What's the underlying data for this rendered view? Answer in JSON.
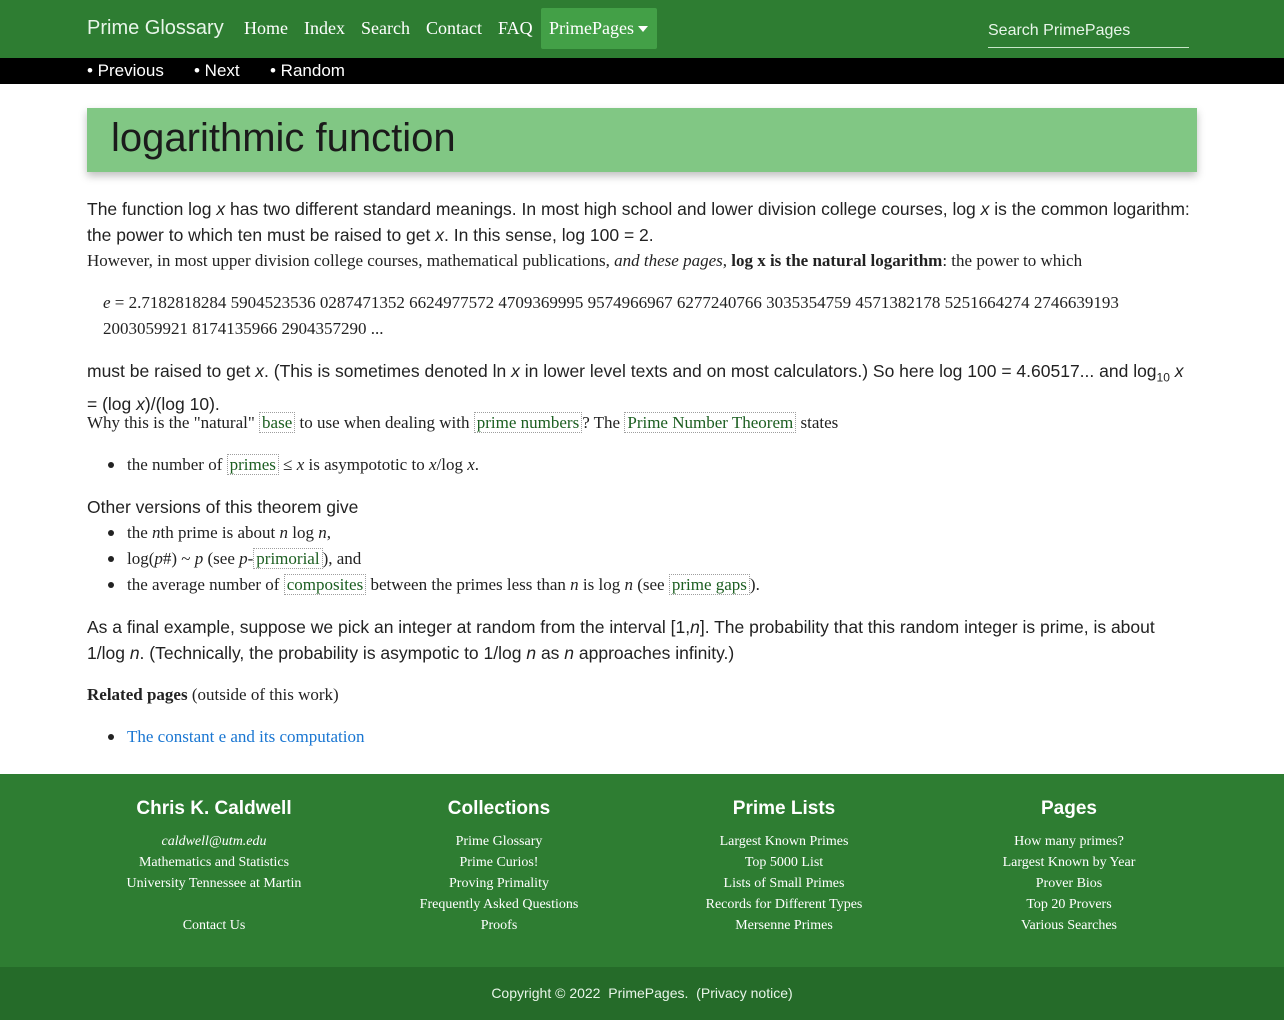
{
  "navbar": {
    "brand": "Prime Glossary",
    "links": [
      "Home",
      "Index",
      "Search",
      "Contact",
      "FAQ"
    ],
    "active": "PrimePages",
    "search_placeholder": "Search PrimePages"
  },
  "subnav": {
    "previous": "• Previous",
    "next": "• Next",
    "random": "• Random"
  },
  "title": "logarithmic function",
  "content": {
    "p1_a": "The function log ",
    "p1_b": " has two different standard meanings. In most high school and lower division college courses, log ",
    "p1_c": " is the common logarithm: the power to which ten must be raised to get ",
    "p1_d": ". In this sense, log 100 = 2.",
    "x": "x",
    "p2_a": "However, in most upper division college courses, mathematical publications, ",
    "p2_em": "and these pages",
    "p2_strong": "log x is the natural logarithm",
    "p2_b": ": the power to which",
    "e_var": "e",
    "e_value": " = 2.7182818284 5904523536 0287471352 6624977572 4709369995 9574966967 6277240766 3035354759 4571382178 5251664274 2746639193 2003059921 8174135966 2904357290 ...",
    "p3_a": "must be raised to get ",
    "p3_b": ". (This is sometimes denoted ln ",
    "p3_c": " in lower level texts and on most calculators.) So here log 100 = 4.60517... and log",
    "p3_sub": "10",
    "p3_d": " = (log ",
    "p3_e": ")/(log 10).",
    "p4_a": "Why this is the \"natural\" ",
    "p4_link1": "base",
    "p4_b": " to use when dealing with ",
    "p4_link2": "prime numbers",
    "p4_c": "? The ",
    "p4_link3": "Prime Number Theorem",
    "p4_d": " states",
    "li1_a": "the number of ",
    "li1_link": "primes",
    "li1_b": " ≤ ",
    "li1_c": " is asympototic to ",
    "li1_d": "/log ",
    "li1_e": ".",
    "p5": "Other versions of this theorem give",
    "li2_a": "the ",
    "li2_n": "n",
    "li2_b": "th prime is about ",
    "li2_c": " log ",
    "li2_d": ",",
    "li3_a": "log(",
    "li3_p": "p",
    "li3_b": "#) ~ ",
    "li3_c": " (see ",
    "li3_d": "-",
    "li3_link": "primorial",
    "li3_e": "), and",
    "li4_a": "the average number of ",
    "li4_link1": "composites",
    "li4_b": " between the primes less than ",
    "li4_c": " is log ",
    "li4_d": " (see ",
    "li4_link2": "prime gaps",
    "li4_e": ").",
    "p6_a": "As a final example, suppose we pick an integer at random from the interval [1,",
    "p6_b": "]. The probability that this random integer is prime, is about 1/log ",
    "p6_c": ". (Technically, the probability is asympotic to 1/log ",
    "p6_d": " as ",
    "p6_e": " approaches infinity.)",
    "related_strong": "Related pages",
    "related_rest": " (outside of this work)",
    "related_link": "The constant e and its computation"
  },
  "footer": {
    "col1": {
      "title": "Chris K. Caldwell",
      "email": "caldwell@utm.edu",
      "lines": [
        "Mathematics and Statistics",
        "University Tennessee at Martin"
      ],
      "contact": "Contact Us"
    },
    "col2": {
      "title": "Collections",
      "items": [
        "Prime Glossary",
        "Prime Curios!",
        "Proving Primality",
        "Frequently Asked Questions",
        "Proofs"
      ]
    },
    "col3": {
      "title": "Prime Lists",
      "items": [
        "Largest Known Primes",
        "Top 5000 List",
        "Lists of Small Primes",
        "Records for Different Types",
        "Mersenne Primes"
      ]
    },
    "col4": {
      "title": "Pages",
      "items": [
        "How many primes?",
        "Largest Known by Year",
        "Prover Bios",
        "Top 20 Provers",
        "Various Searches"
      ]
    },
    "copyright": "Copyright © 2022",
    "site": "PrimePages",
    "privacy": "Privacy notice"
  }
}
